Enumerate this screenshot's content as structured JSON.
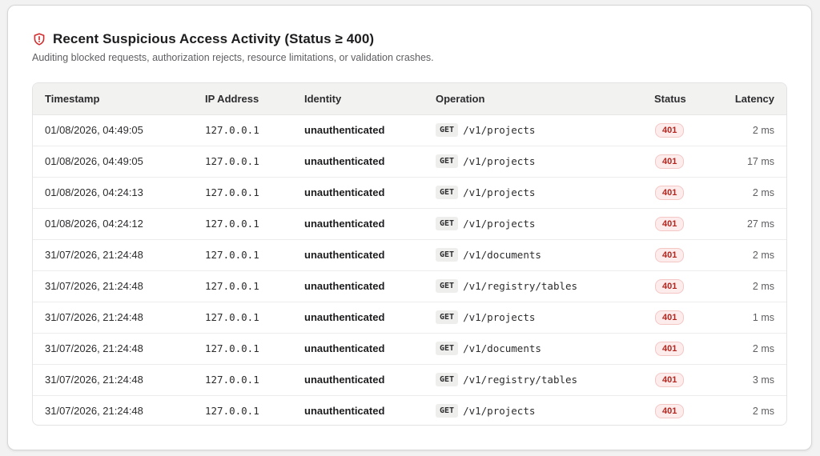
{
  "header": {
    "title": "Recent Suspicious Access Activity (Status ≥ 400)",
    "subtitle": "Auditing blocked requests, authorization rejects, resource limitations, or validation crashes.",
    "icon": "shield-alert-icon",
    "accent_color": "#d12c2c"
  },
  "table": {
    "columns": {
      "timestamp": "Timestamp",
      "ip": "IP Address",
      "identity": "Identity",
      "operation": "Operation",
      "status": "Status",
      "latency": "Latency"
    },
    "rows": [
      {
        "timestamp": "01/08/2026, 04:49:05",
        "ip": "127.0.0.1",
        "identity": "unauthenticated",
        "method": "GET",
        "path": "/v1/projects",
        "status": "401",
        "latency": "2 ms"
      },
      {
        "timestamp": "01/08/2026, 04:49:05",
        "ip": "127.0.0.1",
        "identity": "unauthenticated",
        "method": "GET",
        "path": "/v1/projects",
        "status": "401",
        "latency": "17 ms"
      },
      {
        "timestamp": "01/08/2026, 04:24:13",
        "ip": "127.0.0.1",
        "identity": "unauthenticated",
        "method": "GET",
        "path": "/v1/projects",
        "status": "401",
        "latency": "2 ms"
      },
      {
        "timestamp": "01/08/2026, 04:24:12",
        "ip": "127.0.0.1",
        "identity": "unauthenticated",
        "method": "GET",
        "path": "/v1/projects",
        "status": "401",
        "latency": "27 ms"
      },
      {
        "timestamp": "31/07/2026, 21:24:48",
        "ip": "127.0.0.1",
        "identity": "unauthenticated",
        "method": "GET",
        "path": "/v1/documents",
        "status": "401",
        "latency": "2 ms"
      },
      {
        "timestamp": "31/07/2026, 21:24:48",
        "ip": "127.0.0.1",
        "identity": "unauthenticated",
        "method": "GET",
        "path": "/v1/registry/tables",
        "status": "401",
        "latency": "2 ms"
      },
      {
        "timestamp": "31/07/2026, 21:24:48",
        "ip": "127.0.0.1",
        "identity": "unauthenticated",
        "method": "GET",
        "path": "/v1/projects",
        "status": "401",
        "latency": "1 ms"
      },
      {
        "timestamp": "31/07/2026, 21:24:48",
        "ip": "127.0.0.1",
        "identity": "unauthenticated",
        "method": "GET",
        "path": "/v1/documents",
        "status": "401",
        "latency": "2 ms"
      },
      {
        "timestamp": "31/07/2026, 21:24:48",
        "ip": "127.0.0.1",
        "identity": "unauthenticated",
        "method": "GET",
        "path": "/v1/registry/tables",
        "status": "401",
        "latency": "3 ms"
      },
      {
        "timestamp": "31/07/2026, 21:24:48",
        "ip": "127.0.0.1",
        "identity": "unauthenticated",
        "method": "GET",
        "path": "/v1/projects",
        "status": "401",
        "latency": "2 ms"
      }
    ]
  }
}
